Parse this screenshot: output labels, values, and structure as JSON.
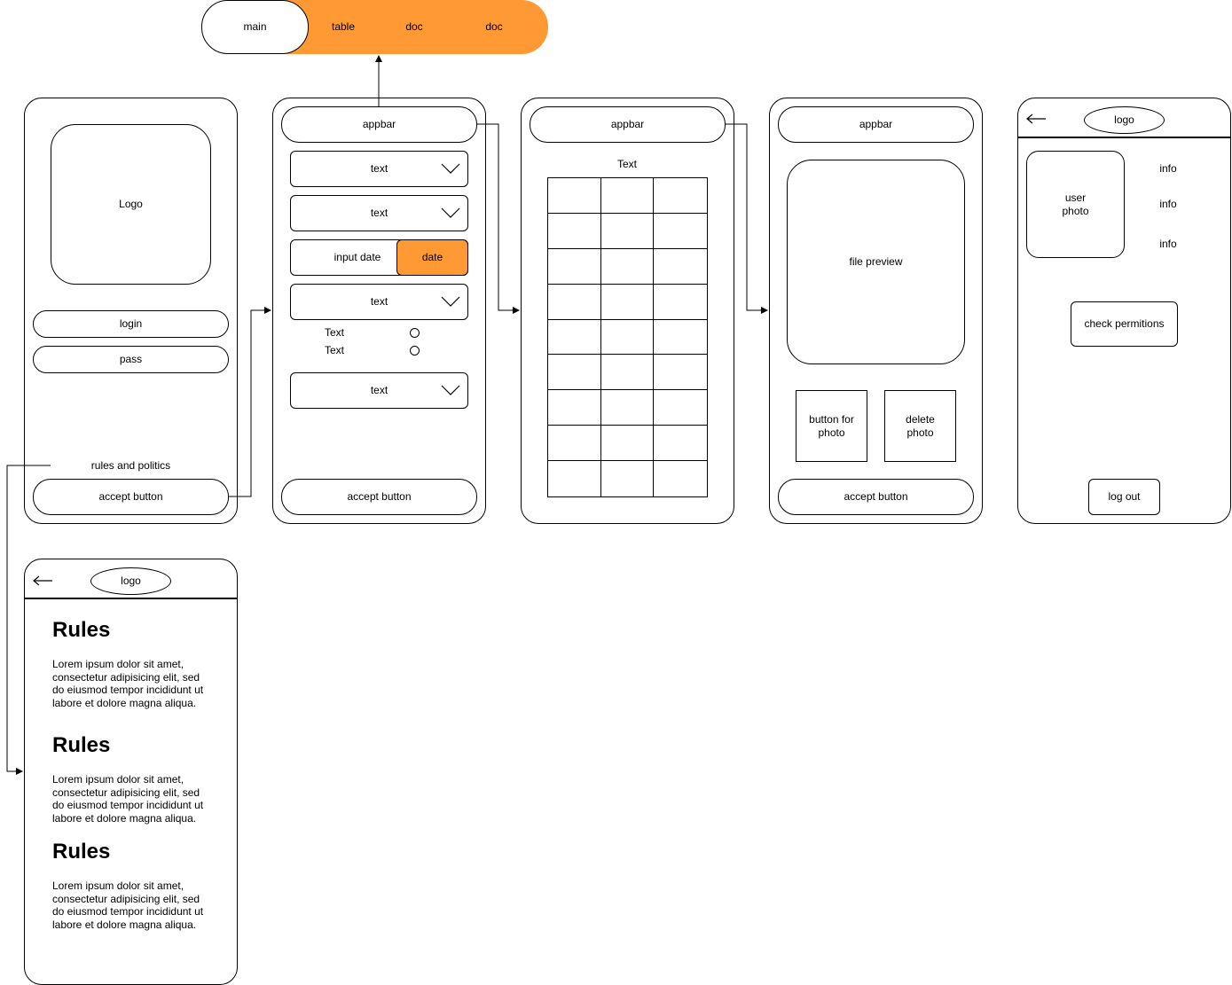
{
  "accent_color": "#FF9933",
  "nav": {
    "main": "main",
    "table": "table",
    "doc1": "doc",
    "doc2": "doc"
  },
  "login_screen": {
    "logo": "Logo",
    "login": "login",
    "pass": "pass",
    "rules_link": "rules and politics",
    "accept": "accept button"
  },
  "form_screen": {
    "appbar": "appbar",
    "select1": "text",
    "select2": "text",
    "input_date": "input date",
    "date_button": "date",
    "select3": "text",
    "radio1": "Text",
    "radio2": "Text",
    "select4": "text",
    "accept": "accept button"
  },
  "table_screen": {
    "appbar": "appbar",
    "title": "Text",
    "rows": 9,
    "cols": 3
  },
  "file_screen": {
    "appbar": "appbar",
    "preview": "file preview",
    "photo_button": "button for photo",
    "delete_button": "delete photo",
    "accept": "accept button"
  },
  "profile_screen": {
    "logo": "logo",
    "user_photo": "user photo",
    "info1": "info",
    "info2": "info",
    "info3": "info",
    "check": "check permitions",
    "logout": "log out"
  },
  "rules_screen": {
    "logo": "logo",
    "sections": [
      {
        "heading": "Rules",
        "body": "Lorem ipsum dolor sit amet, consectetur adipisicing elit, sed do eiusmod tempor incididunt ut labore et dolore magna aliqua."
      },
      {
        "heading": "Rules",
        "body": "Lorem ipsum dolor sit amet, consectetur adipisicing elit, sed do eiusmod tempor incididunt ut labore et dolore magna aliqua."
      },
      {
        "heading": "Rules",
        "body": "Lorem ipsum dolor sit amet, consectetur adipisicing elit, sed do eiusmod tempor incididunt ut labore et dolore magna aliqua."
      }
    ]
  }
}
